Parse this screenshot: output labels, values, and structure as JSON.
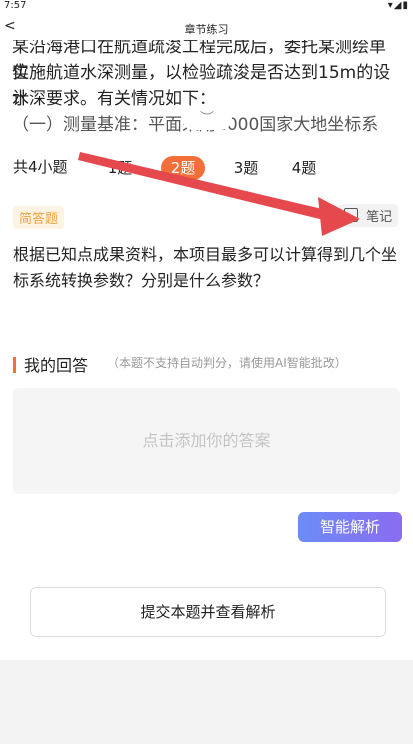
{
  "status": {
    "time": "7:57",
    "icons": "▾◢▮"
  },
  "nav": {
    "back": "<",
    "title": "章节练习"
  },
  "passage": {
    "line1": "某沿海港口在航道疏浚工程完成后，委托某测绘单位",
    "line2": "实施航道水深测量，以检验疏浚是否达到15m的设计",
    "line3": "水深要求。有关情况如下：",
    "line4": "（一）测量基准：平面采用2000国家大地坐标系"
  },
  "handle": "︶",
  "tabs": {
    "count": "共4小题",
    "items": [
      "1题",
      "2题",
      "3题",
      "4题"
    ]
  },
  "question": {
    "tag": "简答题",
    "note": "笔记",
    "text": "根据已知点成果资料，本项目最多可以计算得到几个坐标系统转换参数？分别是什么参数？"
  },
  "answer": {
    "heading": "我的回答",
    "hint": "（本题不支持自动判分，请使用AI智能批改）",
    "placeholder": "点击添加你的答案"
  },
  "buttons": {
    "ai": "智能解析",
    "submit": "提交本题并查看解析"
  },
  "colors": {
    "accent": "#f26f3a",
    "arrow": "#e5484d",
    "ai_gradient": [
      "#6c8cf5",
      "#8a6cf2"
    ]
  }
}
